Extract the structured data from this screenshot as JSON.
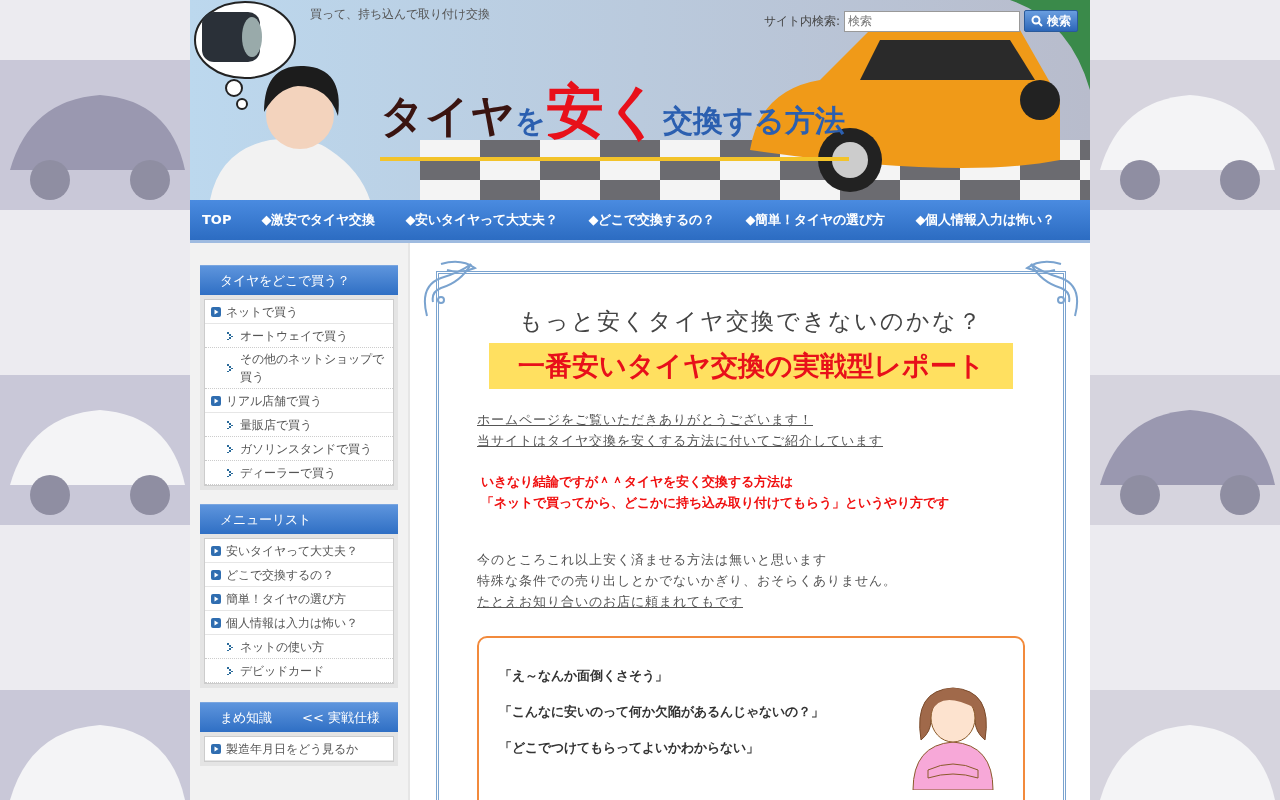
{
  "header": {
    "tagline": "買って、持ち込んで取り付け交換",
    "search": {
      "label": "サイト内検索:",
      "placeholder": "検索",
      "button": "検索"
    },
    "title": [
      {
        "text": "タイヤ",
        "kind": "dark"
      },
      {
        "text": "を",
        "kind": "blue"
      },
      {
        "text": "安く",
        "kind": "red"
      },
      {
        "text": "交換する方法",
        "kind": "blue"
      }
    ]
  },
  "nav": [
    "TOP",
    "◆激安でタイヤ交換",
    "◆安いタイヤって大丈夫？",
    "◆どこで交換するの？",
    "◆簡単！タイヤの選び方",
    "◆個人情報入力は怖い？"
  ],
  "sidebar": [
    {
      "title": [
        "タイヤをどこで買う？"
      ],
      "items": [
        {
          "label": "ネットで買う",
          "children": [
            {
              "label": "オートウェイで買う"
            },
            {
              "label": "その他のネットショップで買う"
            }
          ]
        },
        {
          "label": "リアル店舗で買う",
          "children": [
            {
              "label": "量販店で買う"
            },
            {
              "label": "ガソリンスタンドで買う"
            },
            {
              "label": "ディーラーで買う"
            }
          ]
        }
      ]
    },
    {
      "title": [
        "メニューリスト"
      ],
      "items": [
        {
          "label": "安いタイヤって大丈夫？"
        },
        {
          "label": "どこで交換するの？"
        },
        {
          "label": "簡単！タイヤの選び方"
        },
        {
          "label": "個人情報は入力は怖い？",
          "children": [
            {
              "label": "ネットの使い方"
            },
            {
              "label": "デビッドカード"
            }
          ]
        }
      ]
    },
    {
      "title": [
        "まめ知識",
        "<< 実戦仕様"
      ],
      "items": [
        {
          "label": "製造年月日をどう見るか"
        }
      ]
    }
  ],
  "main": {
    "heading": "もっと安くタイヤ交換できないのかな？",
    "banner": "一番安いタイヤ交換の実戦型レポート",
    "paragraphs": [
      {
        "kind": "link",
        "lines": [
          "ホームページをご覧いただきありがとうございます！",
          "当サイトはタイヤ交換を安くする方法に付いてご紹介しています"
        ]
      },
      {
        "kind": "alert",
        "lines": [
          "いきなり結論ですが＾＾タイヤを安く交換する方法は",
          "「ネットで買ってから、どこかに持ち込み取り付けてもらう」というやり方です"
        ]
      },
      {
        "kind": "text",
        "lines": [
          "今のところこれ以上安く済ませる方法は無いと思います",
          "特殊な条件での売り出しとかでないかぎり、おそらくありません。"
        ]
      },
      {
        "kind": "link",
        "lines": [
          "たとえお知り合いのお店に頼まれてもです"
        ]
      }
    ],
    "quotes": [
      "「え～なんか面倒くさそう」",
      "「こんなに安いのって何か欠陥があるんじゃないの？」",
      "「どこでつけてもらってよいかわからない」"
    ]
  }
}
